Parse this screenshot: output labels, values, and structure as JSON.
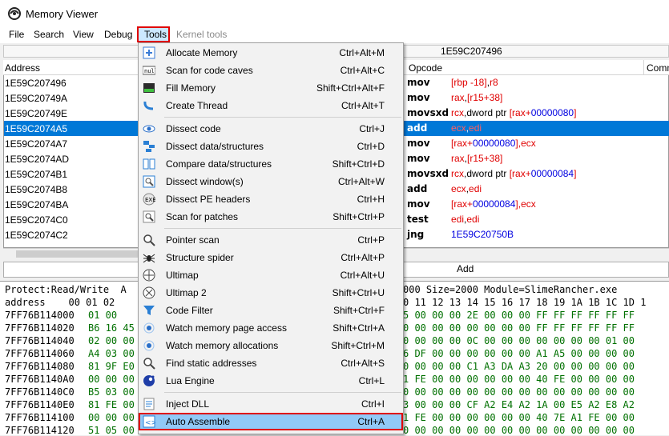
{
  "window": {
    "title": "Memory Viewer",
    "icon": "cheat-engine-icon"
  },
  "menubar": [
    "File",
    "Search",
    "View",
    "Debug",
    "Tools",
    "Kernel tools"
  ],
  "address_strip": "1E59C207496",
  "disasm": {
    "headers": {
      "address": "Address",
      "opcode": "Opcode",
      "comment": "Comm"
    },
    "rows": [
      {
        "address": "1E59C207496",
        "op": "mov",
        "args": [
          [
            "[rbp -18]",
            "red"
          ],
          [
            ",",
            "dark"
          ],
          [
            "r8",
            "red"
          ]
        ]
      },
      {
        "address": "1E59C20749A",
        "op": "mov",
        "args": [
          [
            "rax",
            "red"
          ],
          [
            ",",
            "dark"
          ],
          [
            "[r15+38]",
            "red"
          ]
        ]
      },
      {
        "address": "1E59C20749E",
        "op": "movsxd",
        "args": [
          [
            "rcx",
            "red"
          ],
          [
            ",dword ptr ",
            "dark"
          ],
          [
            "[rax+",
            "red"
          ],
          [
            "00000080",
            "blue"
          ],
          [
            "]",
            "red"
          ]
        ]
      },
      {
        "address": "1E59C2074A5",
        "op": "add",
        "args": [
          [
            "ecx",
            "red"
          ],
          [
            ",",
            "dark"
          ],
          [
            "edi",
            "red"
          ]
        ],
        "selected": true
      },
      {
        "address": "1E59C2074A7",
        "op": "mov",
        "args": [
          [
            "[rax+",
            "red"
          ],
          [
            "00000080",
            "blue"
          ],
          [
            "],",
            "red"
          ],
          [
            "ecx",
            "red"
          ]
        ]
      },
      {
        "address": "1E59C2074AD",
        "op": "mov",
        "args": [
          [
            "rax",
            "red"
          ],
          [
            ",",
            "dark"
          ],
          [
            "[r15+38]",
            "red"
          ]
        ]
      },
      {
        "address": "1E59C2074B1",
        "op": "movsxd",
        "args": [
          [
            "rcx",
            "red"
          ],
          [
            ",dword ptr ",
            "dark"
          ],
          [
            "[rax+",
            "red"
          ],
          [
            "00000084",
            "blue"
          ],
          [
            "]",
            "red"
          ]
        ]
      },
      {
        "address": "1E59C2074B8",
        "op": "add",
        "args": [
          [
            "ecx",
            "red"
          ],
          [
            ",",
            "dark"
          ],
          [
            "edi",
            "red"
          ]
        ]
      },
      {
        "address": "1E59C2074BA",
        "op": "mov",
        "args": [
          [
            "[rax+",
            "red"
          ],
          [
            "00000084",
            "blue"
          ],
          [
            "],",
            "red"
          ],
          [
            "ecx",
            "red"
          ]
        ]
      },
      {
        "address": "1E59C2074C0",
        "op": "test",
        "args": [
          [
            "edi",
            "red"
          ],
          [
            ",",
            "dark"
          ],
          [
            "edi",
            "red"
          ]
        ]
      },
      {
        "address": "1E59C2074C2",
        "op": "jng",
        "args": [
          [
            "1E59C20750B",
            "blue"
          ]
        ]
      }
    ]
  },
  "add_button": "Add",
  "hex": {
    "info_left": "Protect:Read/Write  A",
    "info_right": "000 Size=2000 Module=SlimeRancher.exe",
    "header_left": "address    00 01 02",
    "header_right": "0 11 12 13 14 15 16 17 18 19 1A 1B 1C 1D 1",
    "rows": [
      {
        "addr": "7FF76B114000",
        "left": "01 00",
        "right": "5 00 00 00 2E 00 00 00 FF FF FF FF FF FF"
      },
      {
        "addr": "7FF76B114020",
        "left": "B6 16 45",
        "right": "0 00 00 00 00 00 00 00 FF FF FF FF FF FF"
      },
      {
        "addr": "7FF76B114040",
        "left": "02 00 00",
        "right": "0 00 00 00 0C 00 00 00 00 00 00 00 01 00"
      },
      {
        "addr": "7FF76B114060",
        "left": "A4 03 00",
        "right": "6 DF 00 00 00 00 00 00 A1 A5 00 00 00 00"
      },
      {
        "addr": "7FF76B114080",
        "left": "81 9F E0",
        "right": "0 00 00 00 C1 A3 DA A3 20 00 00 00 00 00"
      },
      {
        "addr": "7FF76B1140A0",
        "left": "00 00 00",
        "right": "1 FE 00 00 00 00 00 00 40 FE 00 00 00 00"
      },
      {
        "addr": "7FF76B1140C0",
        "left": "B5 03 00",
        "right": "0 00 00 00 00 00 00 00 00 00 00 00 00 00"
      },
      {
        "addr": "7FF76B1140E0",
        "left": "81 FE 00",
        "right": "3 00 00 00 CF A2 E4 A2 1A 00 E5 A2 E8 A2"
      },
      {
        "addr": "7FF76B114100",
        "left": "00 00 00",
        "right": "1 FE 00 00 00 00 00 00 40 7E A1 FE 00 00"
      },
      {
        "addr": "7FF76B114120",
        "left": "51 05 00",
        "right": "0 00 00 00 00 00 00 00 00 00 00 00 00 00"
      }
    ]
  },
  "tools_menu": [
    {
      "label": "Allocate Memory",
      "shortcut": "Ctrl+Alt+M",
      "icon": "plus-icon"
    },
    {
      "label": "Scan for code caves",
      "shortcut": "Ctrl+Alt+C",
      "icon": "null-icon"
    },
    {
      "label": "Fill Memory",
      "shortcut": "Shift+Ctrl+Alt+F",
      "icon": "fill-memory-icon"
    },
    {
      "label": "Create Thread",
      "shortcut": "Ctrl+Alt+T",
      "icon": "thread-icon"
    },
    {
      "label": "Dissect code",
      "shortcut": "Ctrl+J",
      "icon": "eye-icon"
    },
    {
      "label": "Dissect data/structures",
      "shortcut": "Ctrl+D",
      "icon": "structures-icon"
    },
    {
      "label": "Compare data/structures",
      "shortcut": "Shift+Ctrl+D",
      "icon": "compare-icon"
    },
    {
      "label": "Dissect window(s)",
      "shortcut": "Ctrl+Alt+W",
      "icon": "window-search-icon"
    },
    {
      "label": "Dissect PE headers",
      "shortcut": "Ctrl+H",
      "icon": "pe-header-icon"
    },
    {
      "label": "Scan for patches",
      "shortcut": "Shift+Ctrl+P",
      "icon": "patch-scan-icon"
    },
    {
      "label": "Pointer scan",
      "shortcut": "Ctrl+P",
      "icon": "magnifier-icon"
    },
    {
      "label": "Structure spider",
      "shortcut": "Ctrl+Alt+P",
      "icon": "spider-icon"
    },
    {
      "label": "Ultimap",
      "shortcut": "Ctrl+Alt+U",
      "icon": "ultimap-icon"
    },
    {
      "label": "Ultimap 2",
      "shortcut": "Shift+Ctrl+U",
      "icon": "ultimap2-icon"
    },
    {
      "label": "Code Filter",
      "shortcut": "Shift+Ctrl+F",
      "icon": "filter-icon"
    },
    {
      "label": "Watch memory page access",
      "shortcut": "Shift+Ctrl+A",
      "icon": "watch-dot-icon"
    },
    {
      "label": "Watch memory allocations",
      "shortcut": "Shift+Ctrl+M",
      "icon": "watch-dot-icon"
    },
    {
      "label": "Find static addresses",
      "shortcut": "Ctrl+Alt+S",
      "icon": "magnifier-icon"
    },
    {
      "label": "Lua Engine",
      "shortcut": "Ctrl+L",
      "icon": "lua-icon"
    },
    {
      "label": "Inject DLL",
      "shortcut": "Ctrl+I",
      "icon": "dll-icon"
    },
    {
      "label": "Auto Assemble",
      "shortcut": "Ctrl+A",
      "icon": "auto-assemble-icon",
      "highlighted": true
    }
  ],
  "colors": {
    "selection": "#0078d7",
    "register": "#e00000",
    "number": "#0000e0",
    "highlight_box": "#e00000",
    "menu_hover": "#91c9f7"
  }
}
